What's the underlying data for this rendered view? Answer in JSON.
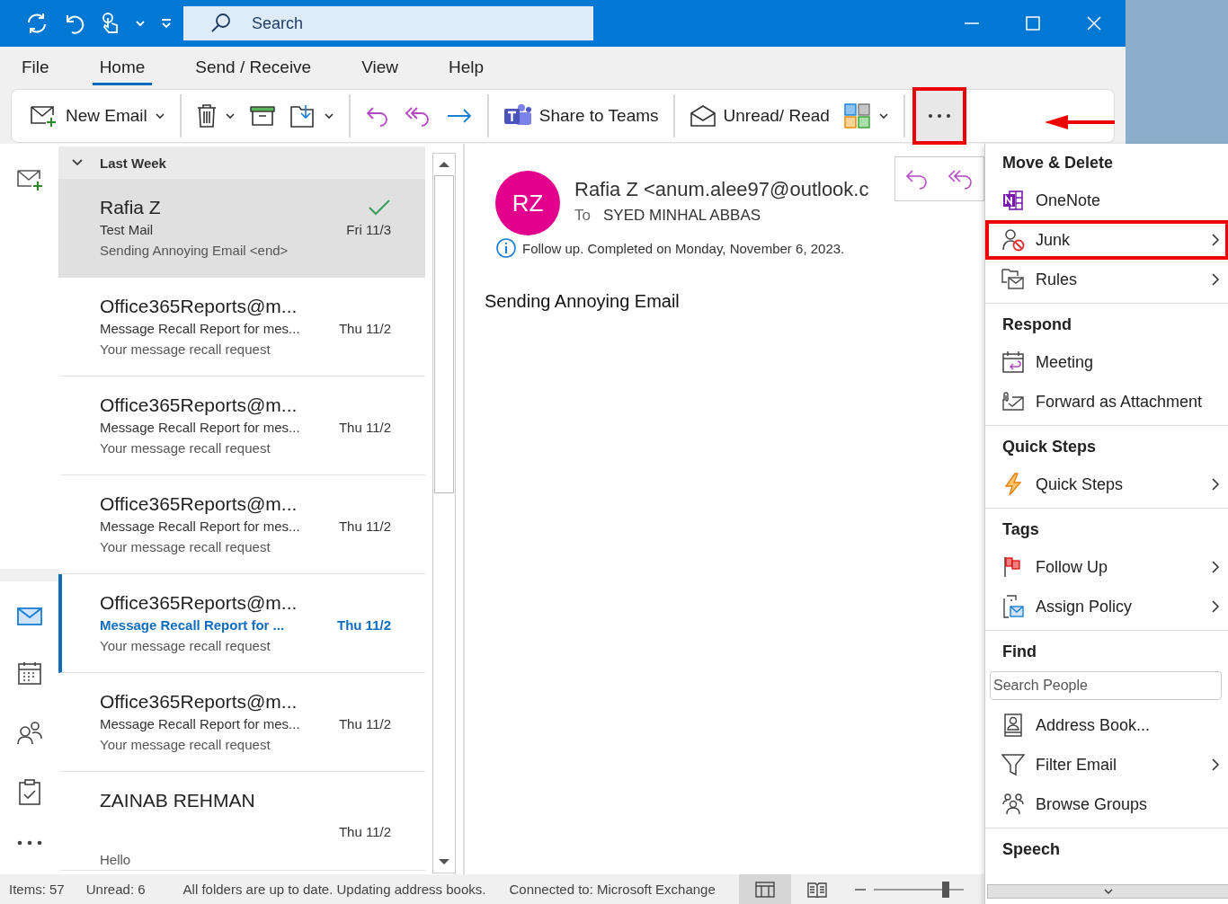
{
  "title_bar": {
    "search": {
      "placeholder": "Search"
    }
  },
  "menu_tabs": [
    {
      "label": "File",
      "selected": false
    },
    {
      "label": "Home",
      "selected": true
    },
    {
      "label": "Send / Receive",
      "selected": false
    },
    {
      "label": "View",
      "selected": false
    },
    {
      "label": "Help",
      "selected": false
    }
  ],
  "ribbon": [
    {
      "kind": "compose",
      "label": "New Email",
      "dropdown": true
    },
    {
      "kind": "separator"
    },
    {
      "kind": "trash",
      "dropdown": true
    },
    {
      "kind": "archive"
    },
    {
      "kind": "move",
      "dropdown": true
    },
    {
      "kind": "separator"
    },
    {
      "kind": "reply"
    },
    {
      "kind": "replyall"
    },
    {
      "kind": "forward"
    },
    {
      "kind": "separator"
    },
    {
      "kind": "teams",
      "label": "Share to Teams"
    },
    {
      "kind": "separator"
    },
    {
      "kind": "envelope",
      "label": "Unread/ Read"
    },
    {
      "kind": "categories",
      "dropdown": true
    },
    {
      "kind": "separator"
    },
    {
      "kind": "more",
      "outlined": true
    }
  ],
  "message_list": {
    "group": "Last Week",
    "messages": [
      {
        "sender": "Rafia Z",
        "subject": "Test Mail",
        "date": "Fri 11/3",
        "preview": "Sending Annoying Email <end>",
        "selected": true,
        "unread": false,
        "completed": true
      },
      {
        "sender": "Office365Reports@m...",
        "subject": "Message Recall Report for mes...",
        "date": "Thu 11/2",
        "preview": "Your message recall request",
        "selected": false,
        "unread": false,
        "completed": false
      },
      {
        "sender": "Office365Reports@m...",
        "subject": "Message Recall Report for mes...",
        "date": "Thu 11/2",
        "preview": "Your message recall request",
        "selected": false,
        "unread": false,
        "completed": false
      },
      {
        "sender": "Office365Reports@m...",
        "subject": "Message Recall Report for mes...",
        "date": "Thu 11/2",
        "preview": "Your message recall request",
        "selected": false,
        "unread": false,
        "completed": false
      },
      {
        "sender": "Office365Reports@m...",
        "subject": "Message Recall Report for ...",
        "date": "Thu 11/2",
        "preview": "Your message recall request",
        "selected": false,
        "unread": true,
        "completed": false
      },
      {
        "sender": "Office365Reports@m...",
        "subject": "Message Recall Report for mes...",
        "date": "Thu 11/2",
        "preview": "Your message recall request",
        "selected": false,
        "unread": false,
        "completed": false
      },
      {
        "sender": "ZAINAB REHMAN",
        "date": "Thu 11/2",
        "preview": "Hello",
        "selected": false,
        "unread": false,
        "completed": false
      }
    ]
  },
  "reading_pane": {
    "initials": "RZ",
    "from": "Rafia Z <anum.alee97@outlook.c",
    "to_label": "To",
    "to": "SYED MINHAL ABBAS",
    "info": "Follow up.  Completed on Monday, November 6, 2023.",
    "body": "Sending Annoying Email"
  },
  "more_menu": {
    "sections": [
      {
        "heading": "Move & Delete",
        "items": [
          {
            "kind": "onenote",
            "label": "OneNote",
            "submenu": false,
            "outlined": false
          },
          {
            "kind": "junk",
            "label": "Junk",
            "submenu": true,
            "outlined": true
          },
          {
            "kind": "rules",
            "label": "Rules",
            "submenu": true,
            "outlined": false
          }
        ]
      },
      {
        "heading": "Respond",
        "items": [
          {
            "kind": "meeting",
            "label": "Meeting",
            "submenu": false,
            "outlined": false
          },
          {
            "kind": "attach",
            "label": "Forward as Attachment",
            "submenu": false,
            "outlined": false
          }
        ]
      },
      {
        "heading": "Quick Steps",
        "items": [
          {
            "kind": "bolt",
            "label": "Quick Steps",
            "submenu": true,
            "outlined": false
          }
        ]
      },
      {
        "heading": "Tags",
        "items": [
          {
            "kind": "flag",
            "label": "Follow Up",
            "submenu": true,
            "outlined": false
          },
          {
            "kind": "policy",
            "label": "Assign Policy",
            "submenu": true,
            "outlined": false
          }
        ]
      },
      {
        "heading": "Find",
        "search_placeholder": "Search People",
        "items": [
          {
            "kind": "book",
            "label": "Address Book...",
            "submenu": false,
            "outlined": false
          },
          {
            "kind": "filter",
            "label": "Filter Email",
            "submenu": true,
            "outlined": false
          },
          {
            "kind": "groups",
            "label": "Browse Groups",
            "submenu": false,
            "outlined": false
          }
        ]
      },
      {
        "heading": "Speech"
      }
    ]
  },
  "status_bar": {
    "items": "Items: 57",
    "unread": "Unread: 6",
    "sync": "All folders are up to date.  Updating address books.",
    "connection": "Connected to: Microsoft Exchange",
    "zoom": {
      "level": 0.8
    }
  }
}
